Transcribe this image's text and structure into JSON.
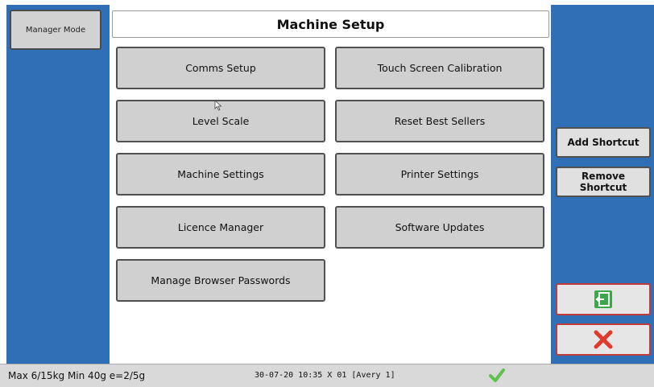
{
  "header": {
    "mode_label": "Manager Mode",
    "title": "Machine Setup"
  },
  "menu": {
    "items": [
      {
        "label": "Comms Setup"
      },
      {
        "label": "Touch Screen Calibration"
      },
      {
        "label": "Level Scale"
      },
      {
        "label": "Reset Best Sellers"
      },
      {
        "label": "Machine Settings"
      },
      {
        "label": "Printer Settings"
      },
      {
        "label": "Licence Manager"
      },
      {
        "label": "Software Updates"
      },
      {
        "label": "Manage Browser Passwords"
      }
    ]
  },
  "sidebar": {
    "add_shortcut": "Add Shortcut",
    "remove_shortcut_line1": "Remove",
    "remove_shortcut_line2": "Shortcut",
    "exit_icon": "exit-icon",
    "cancel_icon": "close-icon"
  },
  "status": {
    "scale_info": "Max 6/15kg Min 40g e=2/5g",
    "datetime_info": "30-07-20 10:35 X 01 [Avery 1]",
    "status_icon": "check-icon"
  },
  "colors": {
    "panel_blue": "#2f6fb6",
    "cancel_red": "#e03a2a",
    "exit_green": "#3aa84a",
    "check_green": "#5cc24a"
  }
}
